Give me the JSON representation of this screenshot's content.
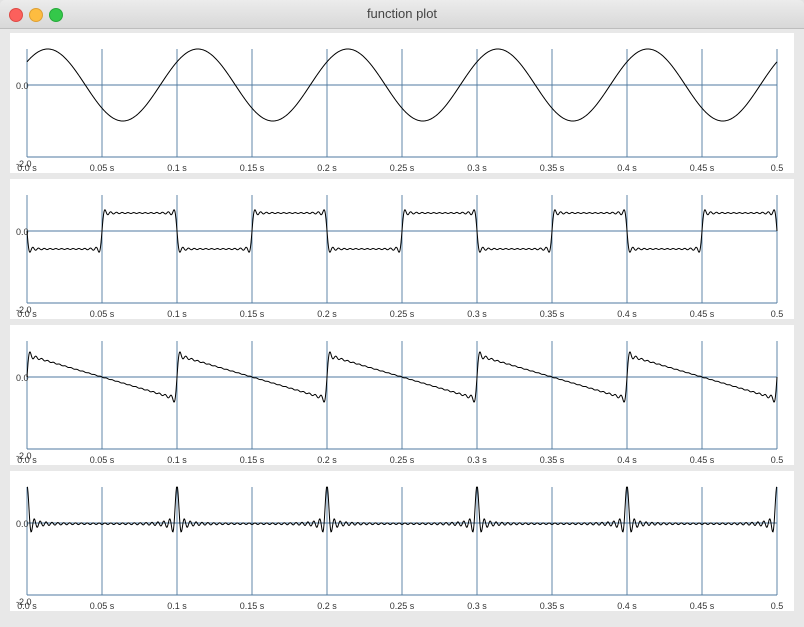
{
  "window": {
    "title": "function plot"
  },
  "colors": {
    "grid": "#4f7aa0",
    "curve": "#000000",
    "panel_bg": "#ffffff"
  },
  "chart_data": [
    {
      "type": "line",
      "function": "sine",
      "x_tick_labels": [
        "0.0 s",
        "0.05 s",
        "0.1 s",
        "0.15 s",
        "0.2 s",
        "0.25 s",
        "0.3 s",
        "0.35 s",
        "0.4 s",
        "0.45 s",
        "0.5"
      ],
      "y_tick_labels": [
        "0.0",
        "-2.0"
      ],
      "xlim": [
        0,
        0.5
      ],
      "ylim": [
        -2,
        1
      ],
      "grid": true
    },
    {
      "type": "line",
      "function": "square",
      "x_tick_labels": [
        "0.0 s",
        "0.05 s",
        "0.1 s",
        "0.15 s",
        "0.2 s",
        "0.25 s",
        "0.3 s",
        "0.35 s",
        "0.4 s",
        "0.45 s",
        "0.5"
      ],
      "y_tick_labels": [
        "0.0",
        "-2.0"
      ],
      "xlim": [
        0,
        0.5
      ],
      "ylim": [
        -2,
        1
      ],
      "grid": true
    },
    {
      "type": "line",
      "function": "sawtooth",
      "x_tick_labels": [
        "0.0 s",
        "0.05 s",
        "0.1 s",
        "0.15 s",
        "0.2 s",
        "0.25 s",
        "0.3 s",
        "0.35 s",
        "0.4 s",
        "0.45 s",
        "0.5"
      ],
      "y_tick_labels": [
        "0.0",
        "-2.0"
      ],
      "xlim": [
        0,
        0.5
      ],
      "ylim": [
        -2,
        1
      ],
      "grid": true
    },
    {
      "type": "line",
      "function": "impulse",
      "x_tick_labels": [
        "0.0 s",
        "0.05 s",
        "0.1 s",
        "0.15 s",
        "0.2 s",
        "0.25 s",
        "0.3 s",
        "0.35 s",
        "0.4 s",
        "0.45 s",
        "0.5"
      ],
      "y_tick_labels": [
        "0.0",
        "-2.0"
      ],
      "xlim": [
        0,
        0.5
      ],
      "ylim": [
        -2,
        1
      ],
      "grid": true
    }
  ]
}
